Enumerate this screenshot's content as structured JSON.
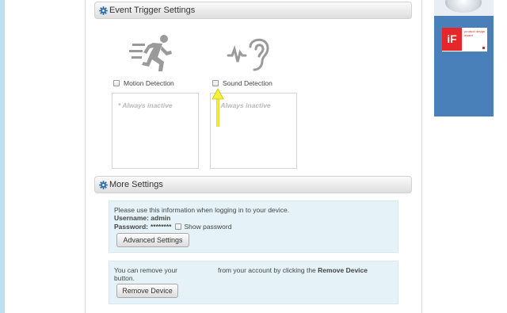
{
  "event_trigger": {
    "title": "Event Trigger Settings",
    "motion_label": "Motion Detection",
    "sound_label": "Sound Detection",
    "motion_status": "* Always inactive",
    "sound_status": "* Always inactive",
    "motion_checked": false,
    "sound_checked": false
  },
  "more_settings": {
    "title": "More Settings",
    "login_hint": "Please use this information when logging in to your device.",
    "username_line": "Username: admin",
    "password_label": "Password:",
    "password_value": "********",
    "show_password_label": "Show password",
    "show_password_checked": false,
    "advanced_button": "Advanced Settings",
    "remove_text_start": "You can remove your",
    "remove_text_middle": "from your account by clicking the",
    "remove_text_bold": "Remove Device",
    "remove_text_end": "button.",
    "remove_button": "Remove Device"
  },
  "ad": {
    "award_mark": "iF",
    "award_caption": "product design award"
  },
  "icons": {
    "section_icon": "gear-icon",
    "motion_icon": "running-person-icon",
    "sound_icon": "ear-sound-icon",
    "annotation": "yellow-arrow-icon"
  },
  "colors": {
    "panel_bg": "#e5f3f8",
    "inactive_text": "#b8b8b8",
    "icon_gray": "#9a9a9a",
    "arrow_yellow": "#f5f03a",
    "ad_blue": "#4a80b9",
    "award_red": "#e5262a"
  }
}
